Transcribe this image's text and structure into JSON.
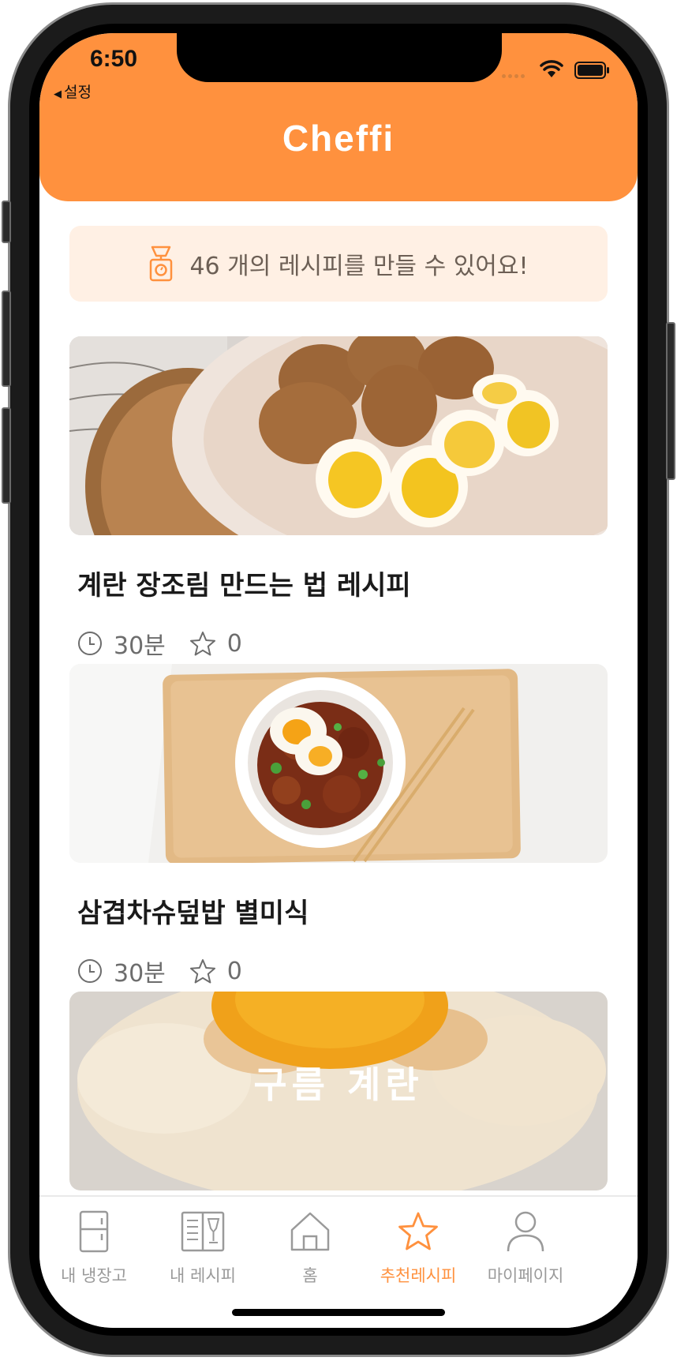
{
  "status_bar": {
    "time": "6:50",
    "back_label": "설정"
  },
  "header": {
    "title": "Cheffi"
  },
  "banner": {
    "text": "46 개의 레시피를 만들 수 있어요!",
    "icon": "kitchen-scale-icon"
  },
  "recipes": [
    {
      "title": "계란 장조림 만드는 법 레시피",
      "time": "30분",
      "rating": "0",
      "image": "braised-eggs-photo"
    },
    {
      "title": "삼겹차슈덮밥 별미식",
      "time": "30분",
      "rating": "0",
      "image": "pork-belly-rice-bowl-photo"
    },
    {
      "title": "",
      "overlay_text": "구름 계란",
      "image": "cloud-egg-photo"
    }
  ],
  "tabs": [
    {
      "label": "내 냉장고",
      "icon": "fridge-icon",
      "active": false
    },
    {
      "label": "내 레시피",
      "icon": "recipe-book-icon",
      "active": false
    },
    {
      "label": "홈",
      "icon": "home-icon",
      "active": false
    },
    {
      "label": "추천레시피",
      "icon": "star-icon",
      "active": true
    },
    {
      "label": "마이페이지",
      "icon": "person-icon",
      "active": false
    }
  ],
  "colors": {
    "accent": "#ff913e",
    "banner_bg": "#fff0e4",
    "inactive_tab": "#9a9a9a"
  }
}
